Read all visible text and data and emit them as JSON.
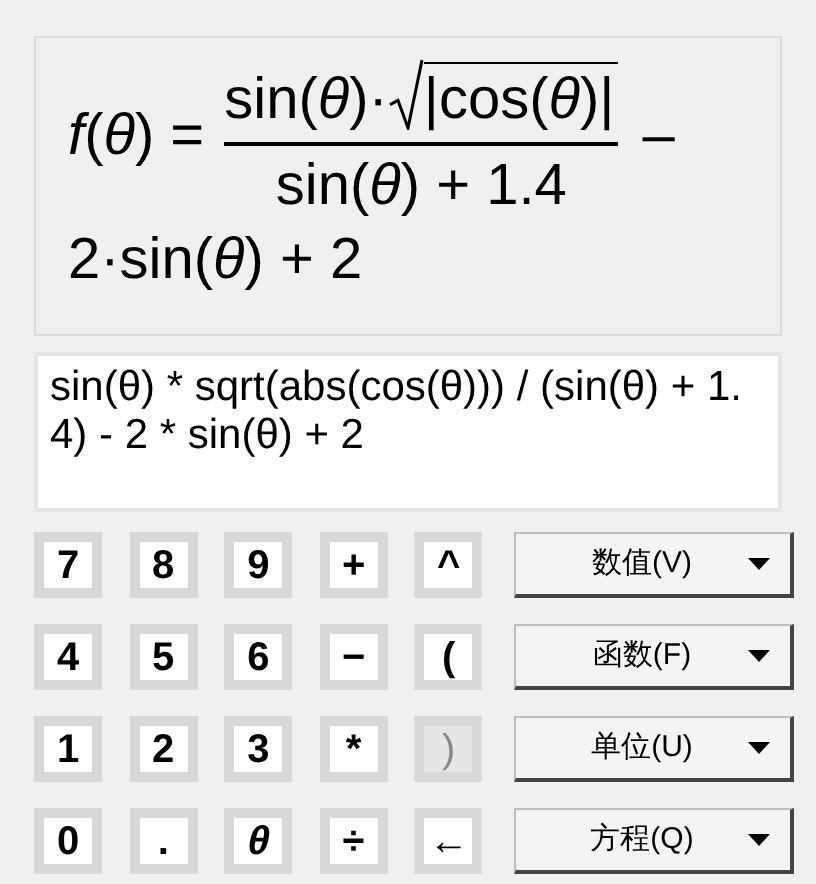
{
  "formula": {
    "lhs": "*f*(*θ*) =",
    "numerator": "sin(*θ*)·",
    "radicand": "|cos(*θ*)|",
    "denominator": "sin(*θ*) + 1.4",
    "trailing": "–",
    "line2": "2·sin(*θ*) + 2"
  },
  "expression": {
    "value": "sin(θ) * sqrt(abs(cos(θ))) / (sin(θ) + 1.4) - 2 * sin(θ) + 2"
  },
  "keys": [
    {
      "label": "7",
      "disabled": false,
      "italic": false
    },
    {
      "label": "8",
      "disabled": false,
      "italic": false
    },
    {
      "label": "9",
      "disabled": false,
      "italic": false
    },
    {
      "label": "+",
      "disabled": false,
      "italic": false
    },
    {
      "label": "^",
      "disabled": false,
      "italic": false
    },
    {
      "label": "4",
      "disabled": false,
      "italic": false
    },
    {
      "label": "5",
      "disabled": false,
      "italic": false
    },
    {
      "label": "6",
      "disabled": false,
      "italic": false
    },
    {
      "label": "−",
      "disabled": false,
      "italic": false
    },
    {
      "label": "(",
      "disabled": false,
      "italic": false
    },
    {
      "label": "1",
      "disabled": false,
      "italic": false
    },
    {
      "label": "2",
      "disabled": false,
      "italic": false
    },
    {
      "label": "3",
      "disabled": false,
      "italic": false
    },
    {
      "label": "*",
      "disabled": false,
      "italic": false
    },
    {
      "label": ")",
      "disabled": true,
      "italic": false
    },
    {
      "label": "0",
      "disabled": false,
      "italic": false
    },
    {
      "label": ".",
      "disabled": false,
      "italic": false
    },
    {
      "label": "θ",
      "disabled": false,
      "italic": true
    },
    {
      "label": "÷",
      "disabled": false,
      "italic": false
    },
    {
      "label": "←",
      "disabled": false,
      "italic": false
    }
  ],
  "menus": [
    {
      "label": "数值(V)"
    },
    {
      "label": "函数(F)"
    },
    {
      "label": "单位(U)"
    },
    {
      "label": "方程(Q)"
    }
  ]
}
